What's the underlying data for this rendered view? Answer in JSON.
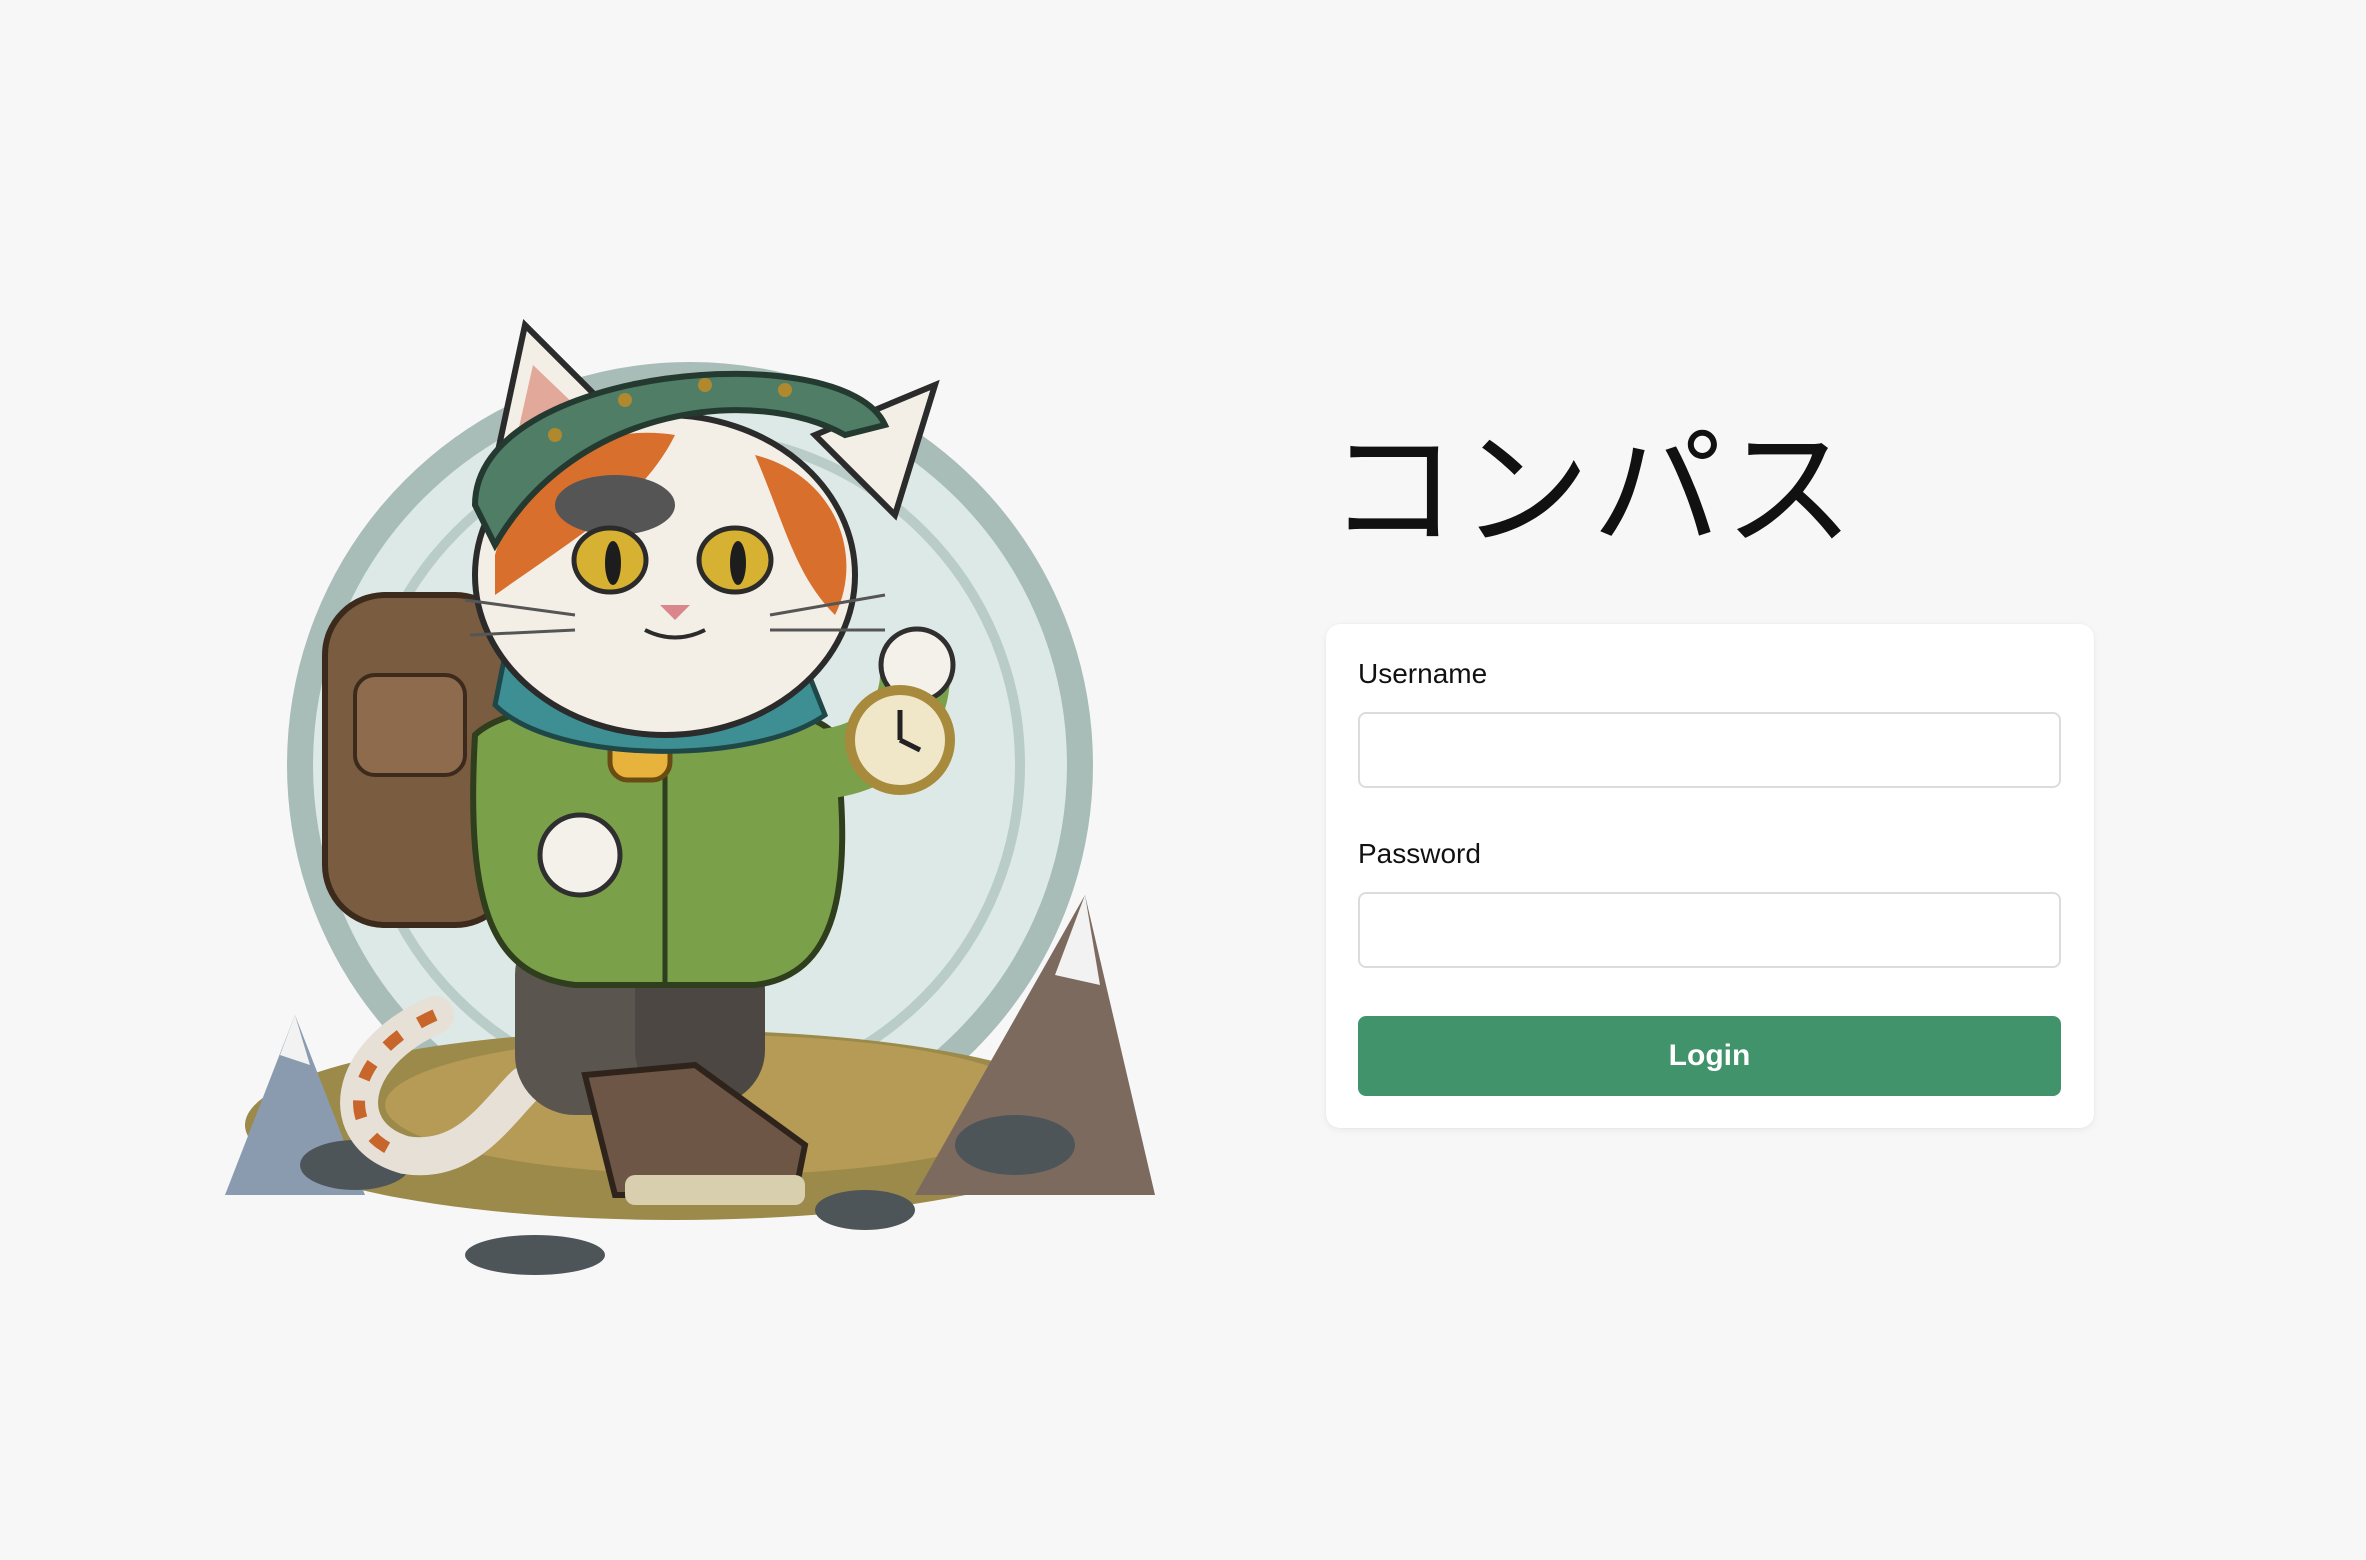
{
  "app": {
    "title": "コンパス"
  },
  "login_form": {
    "username_label": "Username",
    "username_value": "",
    "password_label": "Password",
    "password_value": "",
    "login_button_label": "Login"
  },
  "illustration": {
    "icon": "hiking-cat-mascot-icon"
  },
  "colors": {
    "background": "#f7f7f8",
    "card": "#ffffff",
    "accent": "#41936b",
    "input_border": "#dcdcdf",
    "text": "#111111"
  }
}
